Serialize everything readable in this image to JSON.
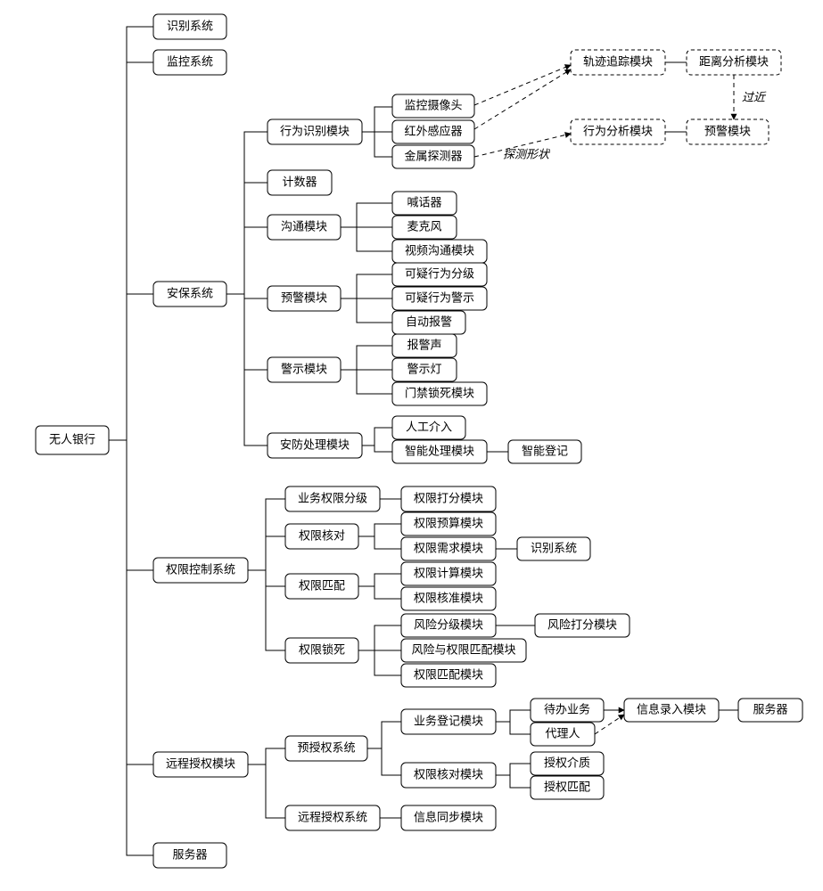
{
  "chart_data": {
    "type": "tree",
    "root": "无人银行",
    "children": {
      "无人银行": [
        "识别系统",
        "监控系统",
        "安保系统",
        "权限控制系统",
        "远程授权模块",
        "服务器"
      ],
      "安保系统": [
        "行为识别模块",
        "计数器",
        "沟通模块",
        "预警模块",
        "警示模块",
        "安防处理模块"
      ],
      "行为识别模块": [
        "监控摄像头",
        "红外感应器",
        "金属探测器"
      ],
      "沟通模块": [
        "喊话器",
        "麦克风",
        "视频沟通模块"
      ],
      "预警模块": [
        "可疑行为分级",
        "可疑行为警示",
        "自动报警"
      ],
      "警示模块": [
        "报警声",
        "警示灯",
        "门禁锁死模块"
      ],
      "安防处理模块": [
        "人工介入",
        "智能处理模块"
      ],
      "智能处理模块": [
        "智能登记"
      ],
      "权限控制系统": [
        "业务权限分级",
        "权限核对",
        "权限匹配",
        "权限锁死"
      ],
      "业务权限分级": [
        "权限打分模块"
      ],
      "权限核对": [
        "权限预算模块",
        "权限需求模块"
      ],
      "权限需求模块": [
        "识别系统"
      ],
      "权限匹配": [
        "权限计算模块",
        "权限核准模块"
      ],
      "权限锁死": [
        "风险分级模块",
        "风险与权限匹配模块",
        "权限匹配模块"
      ],
      "风险分级模块": [
        "风险打分模块"
      ],
      "远程授权模块": [
        "预授权系统",
        "远程授权系统"
      ],
      "预授权系统": [
        "业务登记模块",
        "权限核对模块"
      ],
      "业务登记模块": [
        "待办业务",
        "代理人"
      ],
      "待办业务": [
        "信息录入模块"
      ],
      "信息录入模块": [
        "服务器"
      ],
      "权限核对模块": [
        "授权介质",
        "授权匹配"
      ],
      "远程授权系统": [
        "信息同步模块"
      ]
    },
    "dashed_nodes": [
      "轨迹追踪模块",
      "距离分析模块",
      "行为分析模块",
      "预警模块(右)"
    ],
    "dashed_edges": [
      {
        "from": "监控摄像头",
        "to": "轨迹追踪模块"
      },
      {
        "from": "红外感应器",
        "to": "轨迹追踪模块"
      },
      {
        "from": "金属探测器",
        "to": "行为分析模块",
        "label": "探测形状"
      },
      {
        "from": "距离分析模块",
        "to": "行为分析模块",
        "label": "过近"
      },
      {
        "from": "代理人",
        "to": "信息录入模块"
      }
    ],
    "solid_side_edges": [
      {
        "from": "轨迹追踪模块",
        "to": "距离分析模块"
      },
      {
        "from": "行为分析模块",
        "to": "预警模块(右)"
      }
    ]
  },
  "nodes": {
    "root": "无人银行",
    "l1_1": "识别系统",
    "l1_2": "监控系统",
    "l1_3": "安保系统",
    "l1_4": "权限控制系统",
    "l1_5": "远程授权模块",
    "l1_6": "服务器",
    "sec_1": "行为识别模块",
    "sec_2": "计数器",
    "sec_3": "沟通模块",
    "sec_4": "预警模块",
    "sec_5": "警示模块",
    "sec_6": "安防处理模块",
    "beh_1": "监控摄像头",
    "beh_2": "红外感应器",
    "beh_3": "金属探测器",
    "com_1": "喊话器",
    "com_2": "麦克风",
    "com_3": "视频沟通模块",
    "warn_1": "可疑行为分级",
    "warn_2": "可疑行为警示",
    "warn_3": "自动报警",
    "alert_1": "报警声",
    "alert_2": "警示灯",
    "alert_3": "门禁锁死模块",
    "secproc_1": "人工介入",
    "secproc_2": "智能处理模块",
    "secproc_3": "智能登记",
    "trk": "轨迹追踪模块",
    "dist": "距离分析模块",
    "behA": "行为分析模块",
    "preR": "预警模块",
    "edge_shape": "探测形状",
    "edge_near": "过近",
    "perm_1": "业务权限分级",
    "perm_2": "权限核对",
    "perm_3": "权限匹配",
    "perm_4": "权限锁死",
    "perm_1a": "权限打分模块",
    "perm_2a": "权限预算模块",
    "perm_2b": "权限需求模块",
    "perm_2c": "识别系统",
    "perm_3a": "权限计算模块",
    "perm_3b": "权限核准模块",
    "perm_4a": "风险分级模块",
    "perm_4b": "风险与权限匹配模块",
    "perm_4c": "权限匹配模块",
    "perm_4d": "风险打分模块",
    "ra_1": "预授权系统",
    "ra_2": "远程授权系统",
    "ra_1a": "业务登记模块",
    "ra_1b": "权限核对模块",
    "ra_1a1": "待办业务",
    "ra_1a2": "代理人",
    "ra_1a3": "信息录入模块",
    "ra_1a4": "服务器",
    "ra_1b1": "授权介质",
    "ra_1b2": "授权匹配",
    "ra_2a": "信息同步模块"
  }
}
